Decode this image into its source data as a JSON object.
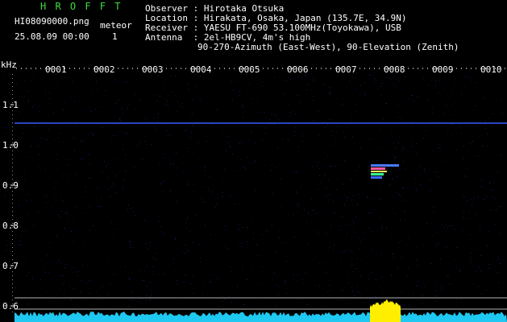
{
  "header": {
    "app_title": "H R O F F T",
    "filename": "HI08090000.png",
    "datetime": "25.08.09 00:00",
    "meteor_label": "meteor",
    "meteor_count": "1"
  },
  "station": {
    "observer": "Observer : Hirotaka Otsuka",
    "location": "Location : Hirakata, Osaka, Japan (135.7E, 34.9N)",
    "receiver": "Receiver : YAESU FT-690 53.100MHz(Toyokawa), USB",
    "antenna": "Antenna  : 2el-HB9CV, 4m's high",
    "antenna_detail": "90-270-Azimuth (East-West), 90-Elevation (Zenith)"
  },
  "axis": {
    "y_unit": "kHz",
    "y_ticks": [
      "1.1",
      "1.0",
      "0.9",
      "0.8",
      "0.7",
      "0.6"
    ],
    "x_ticks": [
      "0001",
      "0002",
      "0003",
      "0004",
      "0005",
      "0006",
      "0007",
      "0008",
      "0009",
      "0010"
    ]
  },
  "colors": {
    "background": "#000000",
    "title_green": "#3fdc3f",
    "carrier_line": "#3a5cff",
    "noise_floor": "#1ec8f0",
    "meteor_burst": "#ffee00",
    "reference_lines": "#b4b4b4",
    "noise_specks": "#1a1a70"
  }
}
